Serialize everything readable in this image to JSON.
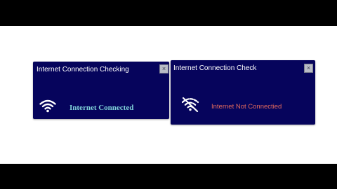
{
  "colors": {
    "dialog_bg": "#06045c",
    "title_text": "#ffffff",
    "connected_text": "#7fd1d9",
    "not_connected_text": "#e46a5c",
    "icon": "#ffffff",
    "letterbox": "#000000"
  },
  "dialogs": [
    {
      "title": "Internet Connection Checking",
      "close_label": "×",
      "icon": "wifi-icon",
      "status": "Internet Connected"
    },
    {
      "title": "Internet Connection Check",
      "close_label": "×",
      "icon": "wifi-off-icon",
      "status": "Internet Not Connectied"
    }
  ]
}
